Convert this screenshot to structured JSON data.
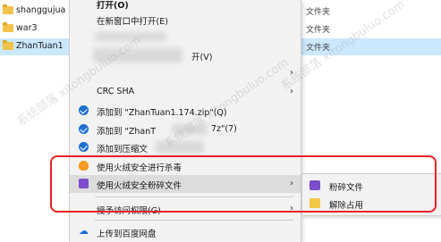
{
  "explorer": {
    "rows": [
      {
        "name": "shanggujua",
        "type": "文件夹"
      },
      {
        "name": "war3",
        "type": "文件夹"
      },
      {
        "name": "ZhanTuan1",
        "type": "文件夹"
      }
    ]
  },
  "context_menu": {
    "open": "打开(O)",
    "open_new_window": "在新窗口中打开(E)",
    "open_with_suffix": "开(V)",
    "crc_sha": "CRC SHA",
    "add_zip": "添加到 \"ZhanTuan1.174.zip\"(Q)",
    "add_7z_prefix": "添加到 \"ZhanT",
    "add_7z_suffix": "7z\"(7)",
    "add_archive": "添加到压缩文",
    "huorong_scan": "使用火绒安全进行杀毒",
    "huorong_shred": "使用火绒安全粉碎文件",
    "grant_access": "授予访问权限(G)",
    "upload_baidu": "上传到百度网盘"
  },
  "submenu": {
    "shred_file": "粉碎文件",
    "unlock": "解除占用"
  },
  "watermark": "系统部落 xitongbuluo.com",
  "colors": {
    "highlight": "#e8212a",
    "selection": "#cce8ff",
    "menu_bg": "#f2f2f2",
    "accent": "#1f6fd1"
  }
}
